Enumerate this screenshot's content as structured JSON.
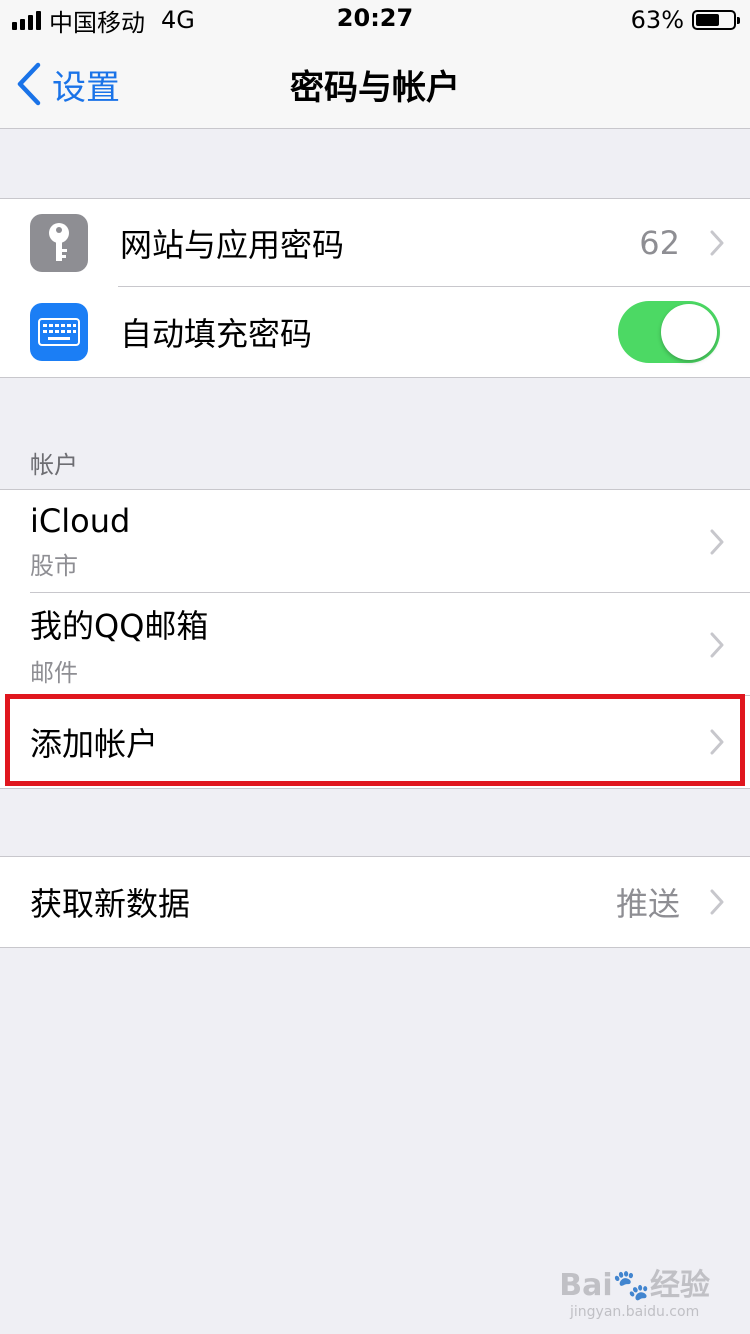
{
  "status_bar": {
    "carrier": "中国移动",
    "network": "4G",
    "time": "20:27",
    "battery_text": "63%",
    "battery_level": 0.63
  },
  "nav": {
    "back_label": "设置",
    "title": "密码与帐户"
  },
  "passwords_group": {
    "website_passwords": {
      "label": "网站与应用密码",
      "count": "62",
      "icon": "key-icon"
    },
    "autofill": {
      "label": "自动填充密码",
      "enabled": true,
      "icon": "keyboard-icon"
    }
  },
  "accounts_section": {
    "header": "帐户",
    "accounts": [
      {
        "name": "iCloud",
        "detail": "股市"
      },
      {
        "name": "我的QQ邮箱",
        "detail": "邮件"
      }
    ],
    "add_account_label": "添加帐户"
  },
  "fetch_group": {
    "label": "获取新数据",
    "value": "推送"
  },
  "watermark": {
    "main": "Bai",
    "main_suffix": "经验",
    "sub": "jingyan.baidu.com"
  },
  "colors": {
    "accent": "#1a73e8",
    "toggle_on": "#4cd964",
    "highlight": "#e0161e"
  }
}
